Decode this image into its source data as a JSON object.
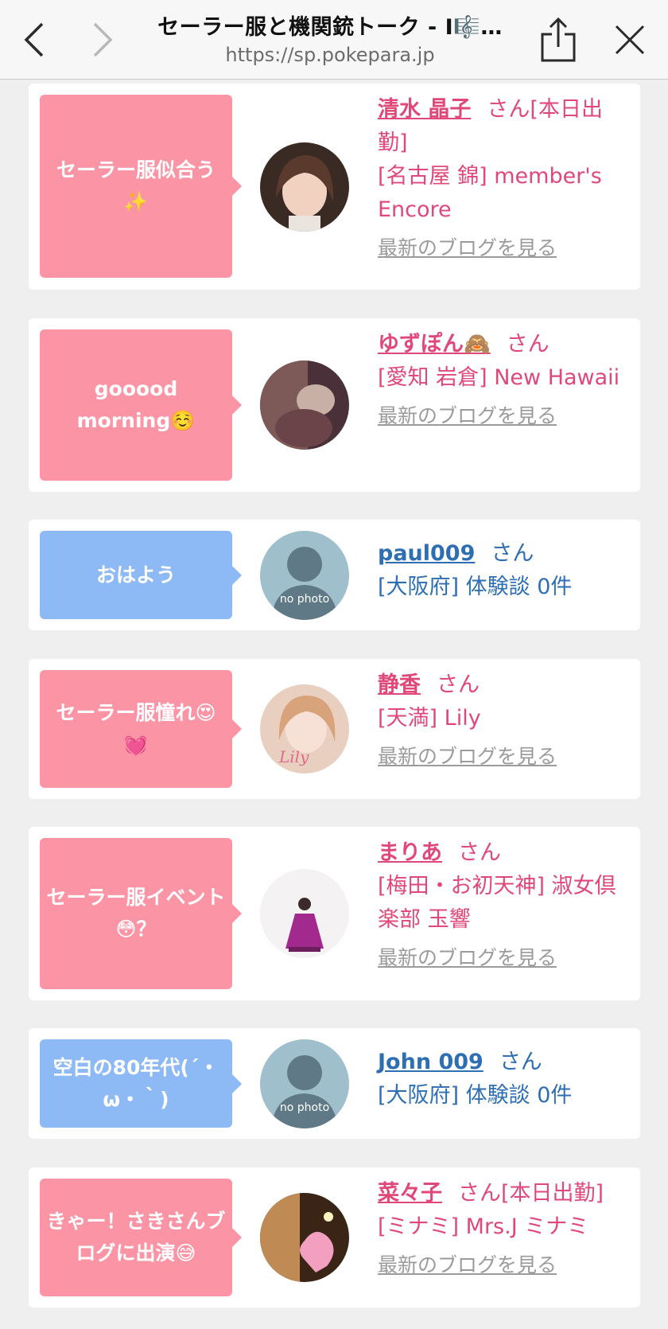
{
  "browser": {
    "title": "セーラー服と機関銃トーク - I🎼…",
    "url": "https://sp.pokepara.jp"
  },
  "feed": {
    "items": [
      {
        "bubble": "セーラー服似合う✨",
        "name": "清水 晶子",
        "suffix": "さん[本日出勤]",
        "shop": "[名古屋 錦] member's Encore",
        "blog": "最新のブログを見る"
      },
      {
        "bubble": "gooood morning☺️",
        "name": "ゆずぽん🙈",
        "suffix": "さん",
        "shop": "[愛知 岩倉] New Hawaii",
        "blog": "最新のブログを見る"
      },
      {
        "bubble": "おはよう",
        "name": "paul009",
        "suffix": "さん",
        "shop": "[大阪府] 体験談 0件",
        "avatar_text": "no photo"
      },
      {
        "bubble": "セーラー服憧れ😍💓",
        "name": "静香",
        "suffix": "さん",
        "shop": "[天満] Lily",
        "blog": "最新のブログを見る"
      },
      {
        "bubble": "セーラー服イベント😳？",
        "name": "まりあ",
        "suffix": "さん",
        "shop": "[梅田・お初天神] 淑女倶楽部 玉響",
        "blog": "最新のブログを見る"
      },
      {
        "bubble": "空白の80年代(´・ω・｀)",
        "name": "John 009",
        "suffix": "さん",
        "shop": "[大阪府] 体験談 0件",
        "avatar_text": "no photo"
      },
      {
        "bubble": "きゃー！さきさんブログに出演😅",
        "name": "菜々子",
        "suffix": "さん[本日出勤]",
        "shop": "[ミナミ] Mrs.J ミナミ",
        "blog": "最新のブログを見る"
      }
    ]
  },
  "colors": {
    "pink_bubble": "#fb95a6",
    "blue_bubble": "#8db9f4",
    "pink_text": "#e0487a",
    "blue_text": "#2e6eb3"
  }
}
